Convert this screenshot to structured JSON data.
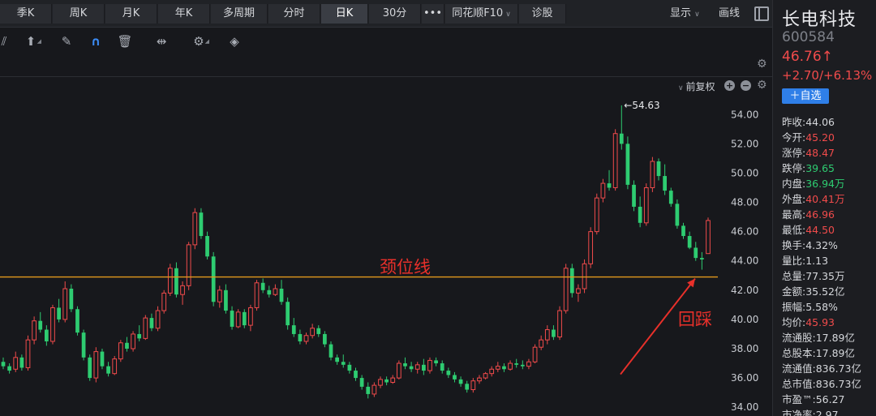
{
  "tabs": [
    {
      "label": "季K",
      "active": false
    },
    {
      "label": "周K",
      "active": false
    },
    {
      "label": "月K",
      "active": false
    },
    {
      "label": "年K",
      "active": false
    },
    {
      "label": "多周期",
      "active": false
    },
    {
      "label": "分时",
      "active": false
    },
    {
      "label": "日K",
      "active": true
    },
    {
      "label": "30分",
      "active": false
    },
    {
      "label": "•••",
      "active": false
    },
    {
      "label": "同花顺F10",
      "active": false,
      "dropdown": true
    },
    {
      "label": "诊股",
      "active": false
    }
  ],
  "toolbar": {
    "display_label": "显示",
    "draw_label": "画线",
    "icons": [
      "line-tool-icon",
      "arrow-up-icon",
      "eraser-icon",
      "magnet-icon",
      "trash-icon",
      "scale-icon",
      "gear-icon",
      "layers-icon"
    ]
  },
  "chart_header": {
    "adjust_label": "前复权",
    "plus": "+",
    "minus": "−"
  },
  "stock": {
    "name": "长电科技",
    "code": "600584",
    "price": "46.76↑",
    "change": "+2.70/+6.13%",
    "watch_button": "＋自选"
  },
  "quotes": [
    {
      "label": "昨收:",
      "value": "44.06",
      "color": "white"
    },
    {
      "label": "今开:",
      "value": "45.20",
      "color": "red"
    },
    {
      "label": "涨停:",
      "value": "48.47",
      "color": "red"
    },
    {
      "label": "跌停:",
      "value": "39.65",
      "color": "green"
    },
    {
      "label": "内盘:",
      "value": "36.94万",
      "color": "green"
    },
    {
      "label": "外盘:",
      "value": "40.41万",
      "color": "red"
    },
    {
      "label": "最高:",
      "value": "46.96",
      "color": "red"
    },
    {
      "label": "最低:",
      "value": "44.50",
      "color": "red"
    },
    {
      "label": "换手:",
      "value": "4.32%",
      "color": "white"
    },
    {
      "label": "量比:",
      "value": "1.13",
      "color": "white"
    },
    {
      "label": "总量:",
      "value": "77.35万",
      "color": "white"
    },
    {
      "label": "金额:",
      "value": "35.52亿",
      "color": "white"
    },
    {
      "label": "振幅:",
      "value": "5.58%",
      "color": "white"
    },
    {
      "label": "均价:",
      "value": "45.93",
      "color": "red"
    },
    {
      "label": "流通股:",
      "value": "17.89亿",
      "color": "white"
    },
    {
      "label": "总股本:",
      "value": "17.89亿",
      "color": "white"
    },
    {
      "label": "流通值:",
      "value": "836.73亿",
      "color": "white"
    },
    {
      "label": "总市值:",
      "value": "836.73亿",
      "color": "white"
    },
    {
      "label": "市盈™:",
      "value": "56.27",
      "color": "white"
    },
    {
      "label": "市净率:",
      "value": "2.97",
      "color": "white"
    }
  ],
  "annotations": {
    "neckline_label": "颈位线",
    "neckline_price": 42.9,
    "pullback_label": "回踩",
    "high_marker": "←54.63"
  },
  "colors": {
    "up": "#f04b4b",
    "down": "#2ecc71",
    "neckline": "#e39a1c",
    "annotation": "#e8302a"
  },
  "chart_data": {
    "type": "candlestick",
    "y_ticks": [
      "54.00",
      "52.00",
      "50.00",
      "48.00",
      "46.00",
      "44.00",
      "42.00",
      "40.00",
      "38.00",
      "36.00",
      "34.00"
    ],
    "ylim": [
      33.4,
      55.4
    ],
    "candles": [
      [
        37.1,
        37.4,
        36.6,
        36.8
      ],
      [
        36.8,
        37.0,
        36.3,
        36.5
      ],
      [
        36.6,
        37.8,
        36.4,
        37.4
      ],
      [
        37.4,
        37.6,
        36.5,
        36.7
      ],
      [
        36.7,
        38.9,
        36.5,
        38.6
      ],
      [
        38.6,
        40.2,
        38.3,
        39.9
      ],
      [
        39.9,
        40.5,
        39.1,
        39.3
      ],
      [
        39.3,
        39.6,
        38.2,
        38.5
      ],
      [
        38.5,
        41.0,
        38.3,
        40.8
      ],
      [
        40.8,
        41.4,
        39.8,
        40.0
      ],
      [
        40.0,
        42.6,
        39.8,
        42.1
      ],
      [
        42.1,
        42.4,
        40.5,
        40.7
      ],
      [
        40.7,
        40.9,
        38.9,
        39.1
      ],
      [
        39.1,
        39.3,
        37.2,
        37.4
      ],
      [
        37.4,
        37.6,
        35.8,
        36.0
      ],
      [
        36.0,
        38.1,
        35.7,
        37.8
      ],
      [
        37.8,
        38.0,
        36.6,
        36.8
      ],
      [
        36.8,
        37.1,
        36.1,
        36.3
      ],
      [
        36.3,
        37.5,
        36.2,
        37.3
      ],
      [
        37.3,
        38.6,
        37.1,
        38.4
      ],
      [
        38.4,
        38.8,
        37.8,
        38.0
      ],
      [
        38.0,
        39.2,
        37.8,
        39.0
      ],
      [
        39.0,
        39.6,
        38.5,
        38.7
      ],
      [
        38.7,
        40.3,
        38.6,
        40.1
      ],
      [
        40.1,
        40.4,
        39.2,
        39.4
      ],
      [
        39.4,
        40.9,
        39.2,
        40.6
      ],
      [
        40.6,
        42.0,
        40.4,
        41.8
      ],
      [
        41.8,
        43.8,
        41.6,
        43.5
      ],
      [
        43.5,
        43.9,
        41.5,
        41.7
      ],
      [
        41.7,
        42.6,
        41.0,
        42.3
      ],
      [
        42.3,
        45.3,
        42.0,
        45.1
      ],
      [
        45.1,
        47.6,
        44.8,
        47.3
      ],
      [
        47.3,
        47.6,
        45.5,
        45.7
      ],
      [
        45.7,
        46.0,
        44.1,
        44.3
      ],
      [
        44.3,
        44.6,
        40.9,
        41.2
      ],
      [
        41.2,
        42.3,
        40.8,
        42.0
      ],
      [
        42.0,
        42.4,
        40.4,
        40.6
      ],
      [
        40.6,
        40.9,
        39.3,
        39.5
      ],
      [
        39.5,
        40.7,
        39.4,
        40.5
      ],
      [
        40.5,
        40.7,
        39.4,
        39.6
      ],
      [
        39.6,
        41.0,
        39.2,
        40.8
      ],
      [
        40.8,
        42.7,
        40.6,
        42.5
      ],
      [
        42.5,
        42.8,
        41.8,
        42.0
      ],
      [
        42.0,
        42.3,
        41.5,
        41.7
      ],
      [
        41.7,
        42.4,
        41.6,
        42.1
      ],
      [
        42.1,
        42.7,
        41.0,
        41.2
      ],
      [
        41.2,
        41.5,
        39.3,
        39.6
      ],
      [
        39.6,
        40.1,
        38.8,
        39.0
      ],
      [
        39.0,
        39.3,
        38.3,
        38.5
      ],
      [
        38.5,
        39.1,
        38.3,
        38.9
      ],
      [
        38.9,
        39.7,
        38.7,
        39.4
      ],
      [
        39.4,
        39.6,
        38.8,
        39.0
      ],
      [
        39.0,
        39.2,
        38.1,
        38.3
      ],
      [
        38.3,
        38.5,
        37.2,
        37.4
      ],
      [
        37.4,
        37.6,
        36.9,
        37.1
      ],
      [
        37.1,
        37.6,
        36.7,
        36.9
      ],
      [
        36.9,
        37.1,
        36.3,
        36.5
      ],
      [
        36.5,
        36.7,
        35.8,
        36.0
      ],
      [
        36.0,
        36.2,
        35.2,
        35.4
      ],
      [
        35.4,
        35.7,
        34.6,
        34.9
      ],
      [
        34.9,
        35.7,
        34.7,
        35.5
      ],
      [
        35.5,
        36.1,
        35.3,
        35.9
      ],
      [
        35.9,
        36.1,
        35.5,
        35.7
      ],
      [
        35.7,
        36.2,
        35.6,
        36.0
      ],
      [
        36.0,
        37.2,
        35.9,
        37.0
      ],
      [
        37.0,
        37.4,
        36.6,
        36.8
      ],
      [
        36.8,
        37.1,
        36.4,
        36.6
      ],
      [
        36.6,
        37.1,
        36.3,
        36.9
      ],
      [
        36.9,
        37.3,
        36.2,
        36.5
      ],
      [
        36.5,
        37.4,
        36.3,
        37.2
      ],
      [
        37.2,
        37.4,
        36.8,
        37.0
      ],
      [
        37.0,
        37.2,
        36.3,
        36.5
      ],
      [
        36.5,
        36.7,
        36.0,
        36.2
      ],
      [
        36.2,
        36.4,
        35.7,
        35.9
      ],
      [
        35.9,
        36.1,
        35.4,
        35.6
      ],
      [
        35.6,
        35.8,
        35.0,
        35.2
      ],
      [
        35.2,
        36.0,
        35.0,
        35.8
      ],
      [
        35.8,
        36.2,
        35.6,
        36.0
      ],
      [
        36.0,
        36.4,
        35.9,
        36.3
      ],
      [
        36.3,
        36.8,
        36.1,
        36.6
      ],
      [
        36.6,
        37.1,
        36.4,
        36.8
      ],
      [
        36.8,
        37.0,
        36.4,
        36.6
      ],
      [
        36.6,
        37.2,
        36.5,
        37.0
      ],
      [
        37.0,
        37.3,
        36.7,
        36.9
      ],
      [
        36.9,
        37.2,
        36.6,
        36.8
      ],
      [
        36.8,
        37.3,
        36.6,
        37.1
      ],
      [
        37.1,
        38.3,
        37.0,
        38.1
      ],
      [
        38.1,
        38.9,
        37.9,
        38.6
      ],
      [
        38.6,
        39.6,
        38.3,
        39.3
      ],
      [
        39.3,
        39.6,
        38.6,
        38.8
      ],
      [
        38.8,
        40.9,
        38.6,
        40.6
      ],
      [
        40.6,
        43.8,
        40.4,
        43.5
      ],
      [
        43.5,
        43.8,
        41.5,
        41.8
      ],
      [
        41.8,
        42.4,
        41.2,
        42.1
      ],
      [
        42.1,
        44.1,
        41.8,
        43.8
      ],
      [
        43.8,
        46.3,
        43.5,
        46.0
      ],
      [
        46.0,
        48.6,
        45.8,
        48.3
      ],
      [
        48.3,
        49.6,
        48.0,
        49.3
      ],
      [
        49.3,
        50.2,
        48.8,
        49.0
      ],
      [
        49.0,
        53.0,
        48.8,
        52.7
      ],
      [
        52.7,
        54.63,
        51.6,
        52.0
      ],
      [
        52.0,
        52.5,
        48.9,
        49.2
      ],
      [
        49.2,
        49.5,
        47.4,
        47.7
      ],
      [
        47.7,
        48.4,
        46.3,
        46.6
      ],
      [
        46.6,
        49.3,
        46.4,
        49.0
      ],
      [
        49.0,
        51.1,
        48.7,
        50.8
      ],
      [
        50.8,
        51.0,
        49.5,
        49.8
      ],
      [
        49.8,
        50.6,
        48.5,
        48.8
      ],
      [
        48.8,
        49.0,
        47.7,
        47.9
      ],
      [
        47.9,
        48.2,
        46.2,
        46.4
      ],
      [
        46.4,
        46.6,
        45.5,
        45.7
      ],
      [
        45.7,
        46.0,
        44.8,
        44.9
      ],
      [
        44.9,
        45.3,
        44.0,
        44.2
      ],
      [
        44.2,
        44.6,
        43.4,
        44.1
      ],
      [
        44.5,
        46.96,
        44.5,
        46.76
      ]
    ]
  }
}
